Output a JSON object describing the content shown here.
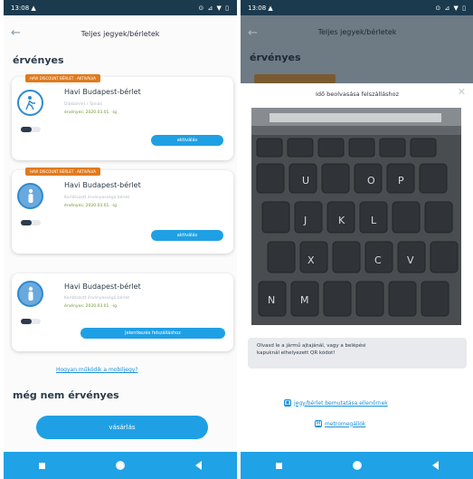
{
  "left_screen": {
    "status": {
      "time": "13:08 ▲",
      "icons": "⊙ ⊿ ▼ ▯"
    },
    "header": {
      "title": "Teljes jegyek/bérletek"
    },
    "sections": {
      "valid": "érvényes",
      "not_yet_valid": "még nem érvényes"
    },
    "tickets": [
      {
        "badge": "HAVI DISCOUNT BÉRLET · AKTIVÁLVA",
        "title": "Havi Budapest-bérlet",
        "subtitle": "Diákbérlet / Tanuló",
        "validity": "érvényes: 2020.03.01. -ig",
        "button": "aktiválás",
        "icon": "walking-person-icon"
      },
      {
        "badge": "HAVI DISCOUNT BÉRLET · AKTIVÁLVA",
        "title": "Havi Budapest-bérlet",
        "subtitle": "Korlátozott érvényességű bérlet",
        "validity": "érvényes: 2020.03.01. -ig",
        "button": "aktiválás",
        "icon": "person-icon"
      },
      {
        "badge": "",
        "title": "Havi Budapest-bérlet",
        "subtitle": "Korlátozott érvényességű bérlet",
        "validity": "érvényes: 2020.03.01. -ig",
        "button": "Jelentkezés felszálláshoz",
        "icon": "person-icon"
      }
    ],
    "how_link": "Hogyan működik a mobiljegy?",
    "buy_button": "vásárlás"
  },
  "right_screen": {
    "status": {
      "time": "13:08 ▲",
      "icons": "⊙ ⊿ ▼ ▯"
    },
    "header": {
      "title": "Teljes jegyek/bérletek"
    },
    "section": "érvényes",
    "sheet": {
      "title": "Idő beolvasása felszálláshoz",
      "instruction_line1": "Olvasd le a jármű ajtajánál, vagy a belépési",
      "instruction_line2": "kapuknál elhelyezett QR kódot!",
      "link_show": "jegy/bérlet bemutatása ellenőrnek",
      "link_metro": "metromegállók"
    }
  }
}
